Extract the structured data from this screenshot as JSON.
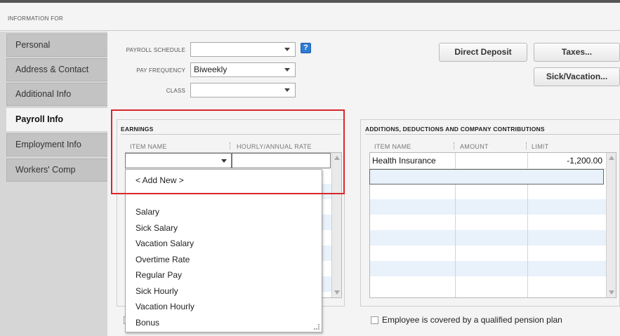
{
  "header": {
    "label": "INFORMATION FOR"
  },
  "sidebar": {
    "items": [
      {
        "label": "Personal",
        "active": false
      },
      {
        "label": "Address & Contact",
        "active": false
      },
      {
        "label": "Additional Info",
        "active": false
      },
      {
        "label": "Payroll Info",
        "active": true
      },
      {
        "label": "Employment Info",
        "active": false
      },
      {
        "label": "Workers' Comp",
        "active": false
      }
    ]
  },
  "form": {
    "payroll_schedule_label": "PAYROLL SCHEDULE",
    "payroll_schedule_value": "",
    "pay_frequency_label": "PAY FREQUENCY",
    "pay_frequency_value": "Biweekly",
    "class_label": "CLASS",
    "class_value": "",
    "help_icon": "?"
  },
  "buttons": {
    "direct_deposit": "Direct Deposit",
    "taxes": "Taxes...",
    "sick_vacation": "Sick/Vacation..."
  },
  "earnings": {
    "title": "EARNINGS",
    "col_item": "ITEM NAME",
    "col_rate": "HOURLY/ANNUAL RATE"
  },
  "additions": {
    "title": "ADDITIONS, DEDUCTIONS AND COMPANY CONTRIBUTIONS",
    "col_item": "ITEM NAME",
    "col_amount": "AMOUNT",
    "col_limit": "LIMIT",
    "rows": [
      {
        "item": "Health Insurance",
        "amount": "",
        "limit": "-1,200.00"
      }
    ]
  },
  "dropdown": {
    "add_new": "< Add New >",
    "items": [
      "Salary",
      "Sick Salary",
      "Vacation Salary",
      "Overtime Rate",
      "Regular Pay",
      "Sick Hourly",
      "Vacation Hourly",
      "Bonus"
    ]
  },
  "pension": {
    "label": "Employee is covered by a qualified pension plan",
    "checked": false
  },
  "colors": {
    "highlight_border": "#d9262b",
    "alt_row": "#e9f2fb",
    "help_icon": "#2f7bd6"
  }
}
